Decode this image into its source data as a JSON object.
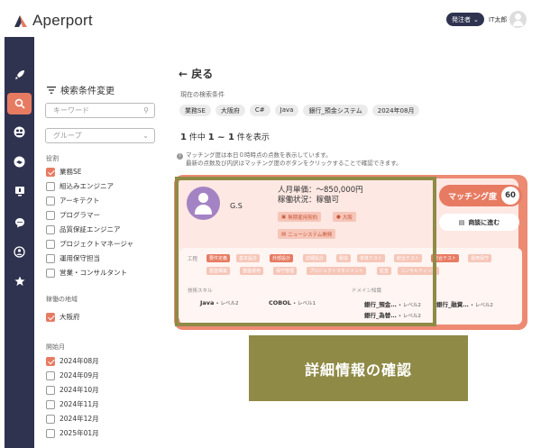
{
  "app": {
    "name": "Aperport",
    "role_label": "発注者",
    "user_name": "IT太郎"
  },
  "nav": {
    "icons": [
      "rocket-icon",
      "search-icon",
      "group-icon",
      "handshake-icon",
      "monitor-icon",
      "chat-icon",
      "team-icon",
      "star-icon"
    ],
    "active_index": 1
  },
  "filter": {
    "title": "検索条件変更",
    "keyword_placeholder": "キーワード",
    "group_placeholder": "グループ",
    "role_section": "役割",
    "roles": [
      {
        "label": "業務SE",
        "checked": true
      },
      {
        "label": "組込みエンジニア",
        "checked": false
      },
      {
        "label": "アーキテクト",
        "checked": false
      },
      {
        "label": "プログラマー",
        "checked": false
      },
      {
        "label": "品質保証エンジニア",
        "checked": false
      },
      {
        "label": "プロジェクトマネージャ",
        "checked": false
      },
      {
        "label": "運用保守担当",
        "checked": false
      },
      {
        "label": "営業・コンサルタント",
        "checked": false
      }
    ],
    "region_section": "稼働の地域",
    "regions": [
      {
        "label": "大阪府",
        "checked": true
      }
    ],
    "start_section": "開始月",
    "months": [
      {
        "label": "2024年08月",
        "checked": true
      },
      {
        "label": "2024年09月",
        "checked": false
      },
      {
        "label": "2024年10月",
        "checked": false
      },
      {
        "label": "2024年11月",
        "checked": false
      },
      {
        "label": "2024年12月",
        "checked": false
      },
      {
        "label": "2025年01月",
        "checked": false
      }
    ]
  },
  "main": {
    "back": "← 戻る",
    "current_conditions": "現在の検索条件",
    "chips": [
      "業務SE",
      "大阪府",
      "C#",
      "Java",
      "銀行_預金システム",
      "2024年08月"
    ],
    "count": {
      "total": "1",
      "range": "1 ~ 1",
      "suffix_a": "件中",
      "suffix_b": "件を表示"
    },
    "note_line1": "マッチング度は本日０時時点の点数を表示しています。",
    "note_line2": "最新の点数及び内訳はマッチング度のボタンをクリックすることで確認できます。"
  },
  "card": {
    "name": "G.S",
    "price": "人月単価：～850,000円",
    "status": "稼働状況：稼働可",
    "tags": [
      "無期雇用契約",
      "大阪",
      "ニューシステム開発"
    ],
    "match_label": "マッチング度",
    "match_score": "60",
    "negotiate_label": "商談に進む",
    "process_label": "工程",
    "processes": [
      {
        "label": "要件定義",
        "on": true
      },
      {
        "label": "基本設計",
        "on": false
      },
      {
        "label": "外部設計",
        "on": true
      },
      {
        "label": "詳細設計",
        "on": false
      },
      {
        "label": "製造",
        "on": false
      },
      {
        "label": "単体テスト",
        "on": false
      },
      {
        "label": "結合テスト",
        "on": false
      },
      {
        "label": "総合テスト",
        "on": true
      },
      {
        "label": "運用保守",
        "on": false
      },
      {
        "label": "基盤構築",
        "on": false
      },
      {
        "label": "基盤運用",
        "on": false
      },
      {
        "label": "保守管理",
        "on": false
      },
      {
        "label": "プロジェクトマネジメント",
        "on": false
      },
      {
        "label": "監査",
        "on": false
      },
      {
        "label": "コンサルティング",
        "on": false
      }
    ],
    "skill_label": "技術スキル",
    "skills": [
      {
        "name": "Java",
        "level": "• レベル2"
      },
      {
        "name": "COBOL",
        "level": "• レベル1"
      }
    ],
    "domain_label": "ドメイン知識",
    "domains": [
      {
        "name": "銀行_預金…",
        "level": "• レベル2"
      },
      {
        "name": "銀行_融資…",
        "level": "• レベル2"
      },
      {
        "name": "銀行_為替…",
        "level": "• レベル2"
      }
    ]
  },
  "banner": "詳細情報の確認",
  "colors": {
    "accent": "#e77b62",
    "nav": "#2f3350",
    "highlight": "#8f8a46"
  }
}
